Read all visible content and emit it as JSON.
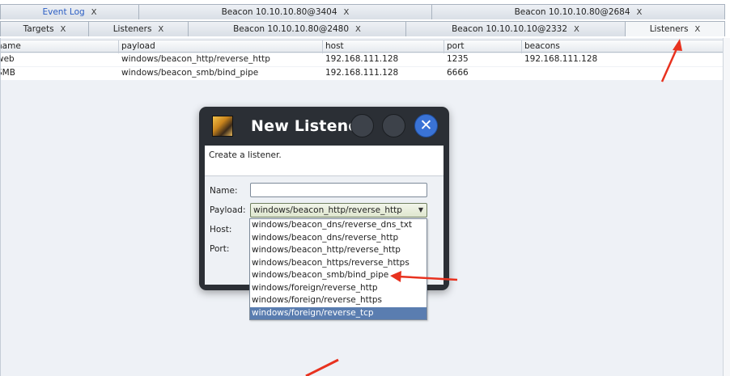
{
  "tabs_top": [
    {
      "label": "Event Log",
      "close": "X"
    },
    {
      "label": "Beacon 10.10.10.80@3404",
      "close": "X"
    },
    {
      "label": "Beacon 10.10.10.80@2684",
      "close": "X"
    }
  ],
  "tabs_second": [
    {
      "label": "Targets",
      "close": "X"
    },
    {
      "label": "Listeners",
      "close": "X"
    },
    {
      "label": "Beacon 10.10.10.80@2480",
      "close": "X"
    },
    {
      "label": "Beacon 10.10.10.10@2332",
      "close": "X"
    },
    {
      "label": "Listeners",
      "close": "X"
    }
  ],
  "table": {
    "columns": [
      "name",
      "payload",
      "host",
      "port",
      "beacons"
    ],
    "rows": [
      [
        "web",
        "windows/beacon_http/reverse_http",
        "192.168.111.128",
        "1235",
        "192.168.111.128"
      ],
      [
        "SMB",
        "windows/beacon_smb/bind_pipe",
        "192.168.111.128",
        "6666",
        ""
      ]
    ]
  },
  "dialog": {
    "title": "New Listene",
    "close_glyph": "✕",
    "description": "Create a listener.",
    "name_label": "Name:",
    "name_value": "",
    "payload_label": "Payload:",
    "payload_value": "windows/beacon_http/reverse_http",
    "host_label": "Host:",
    "port_label": "Port:"
  },
  "payload_options": [
    "windows/beacon_dns/reverse_dns_txt",
    "windows/beacon_dns/reverse_http",
    "windows/beacon_http/reverse_http",
    "windows/beacon_https/reverse_https",
    "windows/beacon_smb/bind_pipe",
    "windows/foreign/reverse_http",
    "windows/foreign/reverse_https",
    "windows/foreign/reverse_tcp"
  ],
  "colors": {
    "annotation_arrow": "#e8321f",
    "selection": "#5a7db0",
    "dialog_frame": "#2b2f35",
    "close_button": "#3a73d6"
  }
}
